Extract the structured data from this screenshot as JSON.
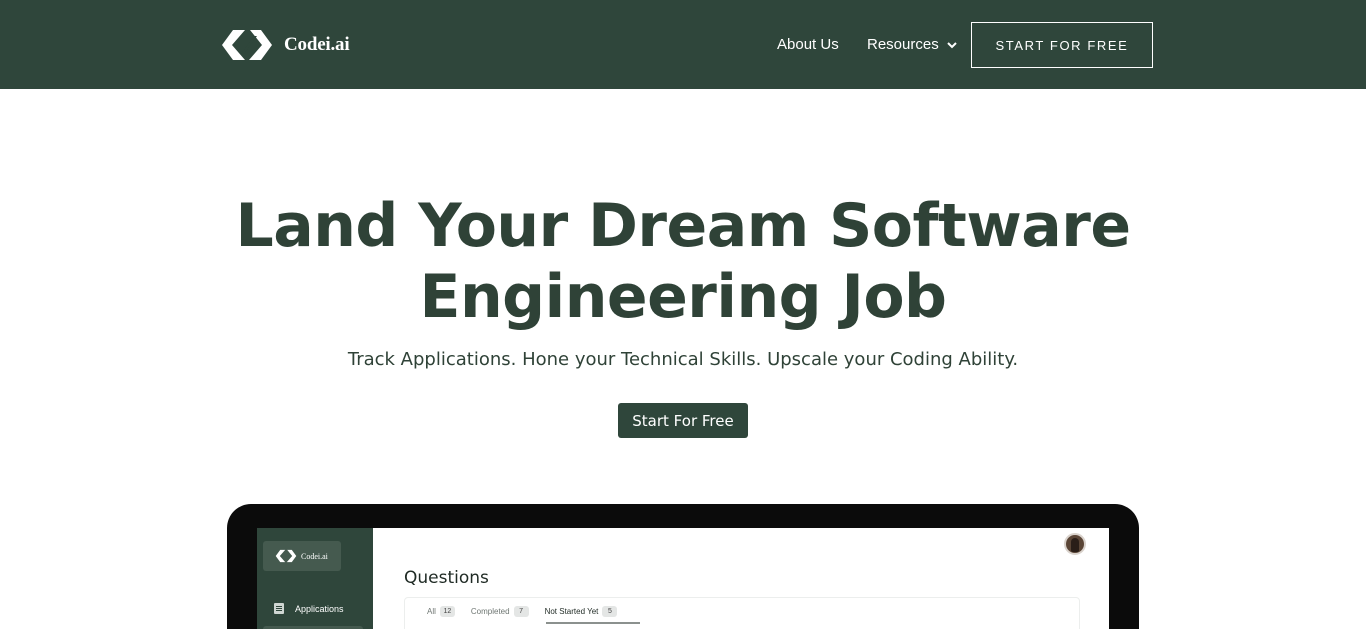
{
  "nav": {
    "brand_name": "Codei.ai",
    "about_label": "About Us",
    "resources_label": "Resources",
    "cta_label": "START FOR FREE",
    "background": "#2f463b"
  },
  "hero": {
    "title_line1": "Land Your Dream Software",
    "title_line2": "Engineering Job",
    "subtitle": "Track Applications. Hone your Technical Skills. Upscale your Coding Ability.",
    "cta_label": "Start For Free"
  },
  "app_preview": {
    "brand_name": "Codei.ai",
    "sidebar_items": [
      {
        "label": "Applications",
        "icon": "document-icon"
      }
    ],
    "page_title": "Questions",
    "tabs": [
      {
        "label": "All",
        "count": "12",
        "active": false
      },
      {
        "label": "Completed",
        "count": "7",
        "active": false
      },
      {
        "label": "Not Started Yet",
        "count": "5",
        "active": true
      }
    ]
  }
}
